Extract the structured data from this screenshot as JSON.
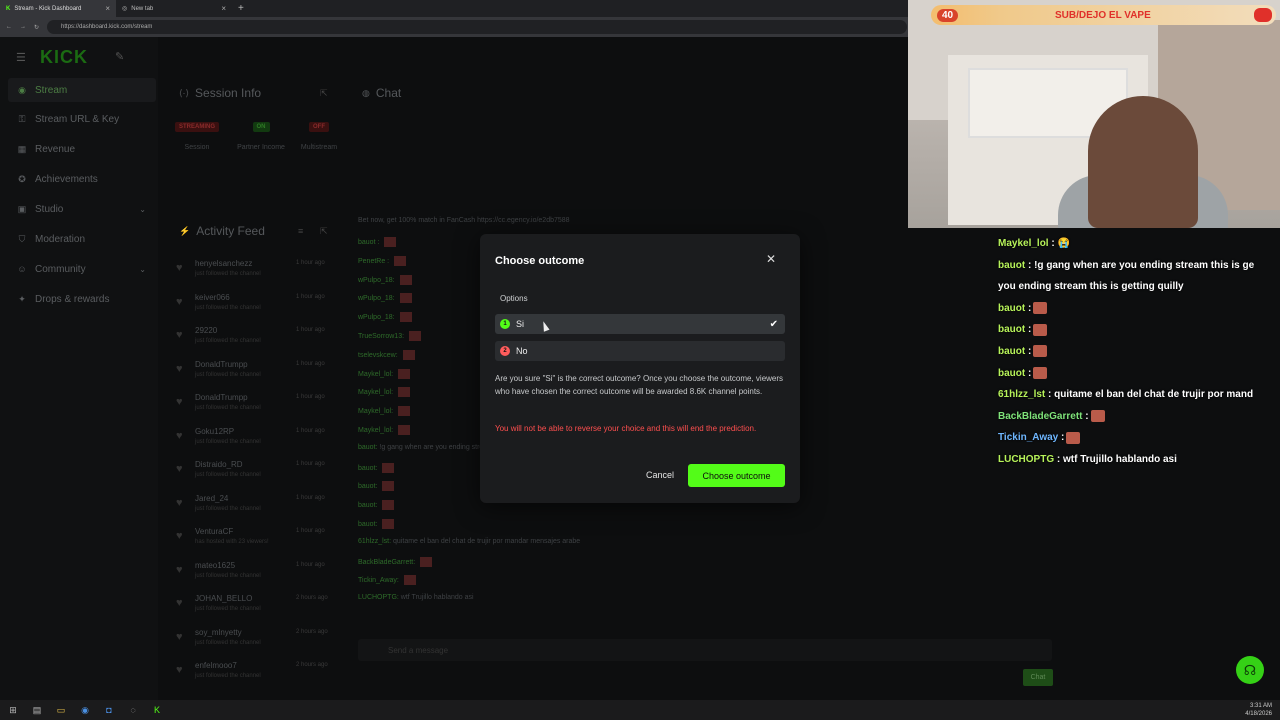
{
  "browser": {
    "tabs": [
      {
        "label": "Stream - Kick Dashboard"
      },
      {
        "label": "New tab"
      }
    ],
    "url": "https://dashboard.kick.com/stream"
  },
  "sidebar": {
    "logo": "KICK",
    "items": [
      {
        "label": "Stream",
        "icon": "broadcast-icon"
      },
      {
        "label": "Stream URL & Key",
        "icon": "key-icon"
      },
      {
        "label": "Revenue",
        "icon": "revenue-icon"
      },
      {
        "label": "Achievements",
        "icon": "trophy-icon"
      },
      {
        "label": "Studio",
        "icon": "studio-icon"
      },
      {
        "label": "Moderation",
        "icon": "shield-icon"
      },
      {
        "label": "Community",
        "icon": "community-icon"
      },
      {
        "label": "Drops & rewards",
        "icon": "gift-icon"
      }
    ]
  },
  "session": {
    "title": "Session Info",
    "stats": [
      {
        "badge": "STREAMING",
        "label": "Session"
      },
      {
        "badge": "ON",
        "label": "Partner Income"
      },
      {
        "badge": "OFF",
        "label": "Multistream"
      }
    ]
  },
  "activity": {
    "title": "Activity Feed",
    "items": [
      {
        "name": "henyelsanchezz",
        "sub": "just followed the channel",
        "time": "1 hour ago"
      },
      {
        "name": "keiver066",
        "sub": "just followed the channel",
        "time": "1 hour ago"
      },
      {
        "name": "29220",
        "sub": "just followed the channel",
        "time": "1 hour ago"
      },
      {
        "name": "DonaldTrumpp",
        "sub": "just followed the channel",
        "time": "1 hour ago"
      },
      {
        "name": "DonaldTrumpp",
        "sub": "just followed the channel",
        "time": "1 hour ago"
      },
      {
        "name": "Goku12RP",
        "sub": "just followed the channel",
        "time": "1 hour ago"
      },
      {
        "name": "Distraido_RD",
        "sub": "just followed the channel",
        "time": "1 hour ago"
      },
      {
        "name": "Jared_24",
        "sub": "just followed the channel",
        "time": "1 hour ago"
      },
      {
        "name": "VenturaCF",
        "sub": "has hosted with 23 viewers!",
        "time": "1 hour ago"
      },
      {
        "name": "mateo1625",
        "sub": "just followed the channel",
        "time": "1 hour ago"
      },
      {
        "name": "JOHAN_BELLO",
        "sub": "just followed the channel",
        "time": "2 hours ago"
      },
      {
        "name": "soy_mlnyetty",
        "sub": "just followed the channel",
        "time": "2 hours ago"
      },
      {
        "name": "enfelmooo7",
        "sub": "just followed the channel",
        "time": "2 hours ago"
      }
    ]
  },
  "chat": {
    "title": "Chat",
    "promo": "Bet now, get 100% match in FanCash https://cc.egency.io/e2db7588",
    "lines": [
      {
        "user": "bauot :",
        "text": ""
      },
      {
        "user": "PenetRe :",
        "text": ""
      },
      {
        "user": "wPulpo_18:",
        "text": ""
      },
      {
        "user": "wPulpo_18:",
        "text": ""
      },
      {
        "user": "wPulpo_18:",
        "text": ""
      },
      {
        "user": "TrueSorrow13:",
        "text": ""
      },
      {
        "user": "tselevskcew:",
        "text": ""
      },
      {
        "user": "Maykel_lol:",
        "text": ""
      },
      {
        "user": "Maykel_lol:",
        "text": ""
      },
      {
        "user": "Maykel_lol:",
        "text": ""
      },
      {
        "user": "Maykel_lol:",
        "text": ""
      },
      {
        "user": "bauot:",
        "text": "!g gang when are you ending stream this is getting quilly"
      },
      {
        "user": "bauot:",
        "text": ""
      },
      {
        "user": "bauot:",
        "text": ""
      },
      {
        "user": "bauot:",
        "text": ""
      },
      {
        "user": "bauot:",
        "text": ""
      },
      {
        "user": "61hlzz_lst:",
        "text": "quitame el ban del chat de trujir por mandar mensajes arabe"
      },
      {
        "user": "BackBladeGarrett:",
        "text": ""
      },
      {
        "user": "Tickin_Away:",
        "text": ""
      },
      {
        "user": "LUCHOPTG:",
        "text": "wtf Trujillo hablando asi"
      }
    ],
    "input_placeholder": "Send a message",
    "send_label": "Chat"
  },
  "modal": {
    "title": "Choose outcome",
    "options_label": "Options",
    "options": [
      {
        "num": "1",
        "label": "Si",
        "color": "#53fc18",
        "selected": true
      },
      {
        "num": "2",
        "label": "No",
        "color": "#ff5c5c",
        "selected": false
      }
    ],
    "confirm_text": "Are you sure \"Si\" is the correct outcome? Once you choose the outcome, viewers who have chosen the correct outcome will be awarded 8.6K channel points.",
    "warning_text": "You will not be able to reverse your choice and this will end the prediction.",
    "cancel_label": "Cancel",
    "confirm_label": "Choose outcome"
  },
  "overlay": {
    "goal_count": "40",
    "goal_label": "SUB/DEJO EL VAPE",
    "chat": [
      {
        "user": "Maykel_lol",
        "color": "#b7f35a",
        "text": " : 😭"
      },
      {
        "user": "bauot",
        "color": "#b7f35a",
        "text": " : !g gang when are you ending stream this is ge"
      },
      {
        "user": "",
        "color": "#ffffff",
        "text": "you ending stream this is getting quilly"
      },
      {
        "user": "bauot",
        "color": "#b7f35a",
        "text": " :",
        "emote": true
      },
      {
        "user": "bauot",
        "color": "#b7f35a",
        "text": " :",
        "emote": true
      },
      {
        "user": "bauot",
        "color": "#b7f35a",
        "text": " :",
        "emote": true
      },
      {
        "user": "bauot",
        "color": "#b7f35a",
        "text": " :",
        "emote": true
      },
      {
        "user": "61hlzz_lst",
        "color": "#b7f35a",
        "text": " : quitame el ban del chat de trujir por mand"
      },
      {
        "user": "BackBladeGarrett",
        "color": "#7fe37a",
        "text": " :",
        "emote": true
      },
      {
        "user": "Tickin_Away",
        "color": "#6fb7ff",
        "text": " :",
        "emote": true
      },
      {
        "user": "LUCHOPTG",
        "color": "#b7f35a",
        "text": " : wtf Trujillo hablando asi"
      }
    ]
  },
  "taskbar": {
    "time": "3:31 AM",
    "date": "4/18/2026"
  }
}
